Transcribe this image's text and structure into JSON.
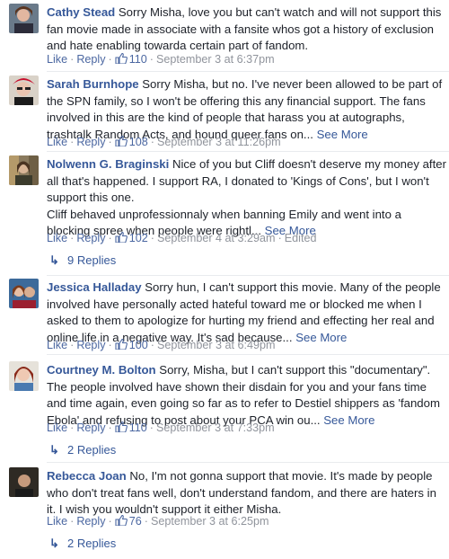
{
  "actions": {
    "like_label": "Like",
    "reply_label": "Reply",
    "separator": "·"
  },
  "comments": [
    {
      "author": "Cathy Stead",
      "text": "Sorry Misha, love you but can't watch and will not support this fan movie made in associate with a fansite whos got a history of exclusion and hate enabling towarda certain part of fandom.",
      "see_more": "",
      "likes": "110",
      "time": "September 3 at 6:37pm",
      "edited": "",
      "replies": ""
    },
    {
      "author": "Sarah Burnhope",
      "text": "Sorry Misha, but no. I've never been allowed to be part of the SPN family, so I won't be offering this any financial support. The fans involved in this are the kind of people that harass you at autographs, trashtalk Random Acts, and hound queer fans on...",
      "see_more": "See More",
      "likes": "108",
      "time": "September 3 at 11:26pm",
      "edited": "",
      "replies": ""
    },
    {
      "author": "Nolwenn G. Braginski",
      "text": "Nice of you but Cliff doesn't deserve my money after all that's happened. I support RA, I donated to 'Kings of Cons', but I won't support this one.",
      "text2": "Cliff behaved unprofessionnaly when banning Emily and went into a blocking spree when people were rightl...",
      "see_more": "See More",
      "likes": "102",
      "time": "September 4 at 3:29am",
      "edited": "Edited",
      "replies": "9 Replies"
    },
    {
      "author": "Jessica Halladay",
      "text": "Sorry hun, I can't support this movie. Many of the people involved have personally acted hateful toward me or blocked me when I asked to them to apologize for hurting my friend and effecting her real and online life in a negative way. It's sad because...",
      "see_more": "See More",
      "likes": "100",
      "time": "September 3 at 6:49pm",
      "edited": "",
      "replies": ""
    },
    {
      "author": "Courtney M. Bolton",
      "text": "Sorry, Misha, but I can't support this \"documentary\". The people involved have shown their disdain for you and your fans time and time again, even going so far as to refer to Destiel shippers as 'fandom Ebola' and refusing to post about your PCA win ou...",
      "see_more": "See More",
      "likes": "110",
      "time": "September 3 at 7:33pm",
      "edited": "",
      "replies": "2 Replies"
    },
    {
      "author": "Rebecca Joan",
      "text": "No, I'm not gonna support that movie. It's made by people who don't treat fans well, don't understand fandom, and there are haters in it. I wish you wouldn't support it either Misha.",
      "see_more": "",
      "likes": "76",
      "time": "September 3 at 6:25pm",
      "edited": "",
      "replies": "2 Replies"
    }
  ],
  "icons": {
    "like": "thumbs-up-icon",
    "reply_arrow": "reply-arrow-icon"
  },
  "colors": {
    "link": "#365899",
    "meta": "#90949c",
    "text": "#1d2129"
  }
}
